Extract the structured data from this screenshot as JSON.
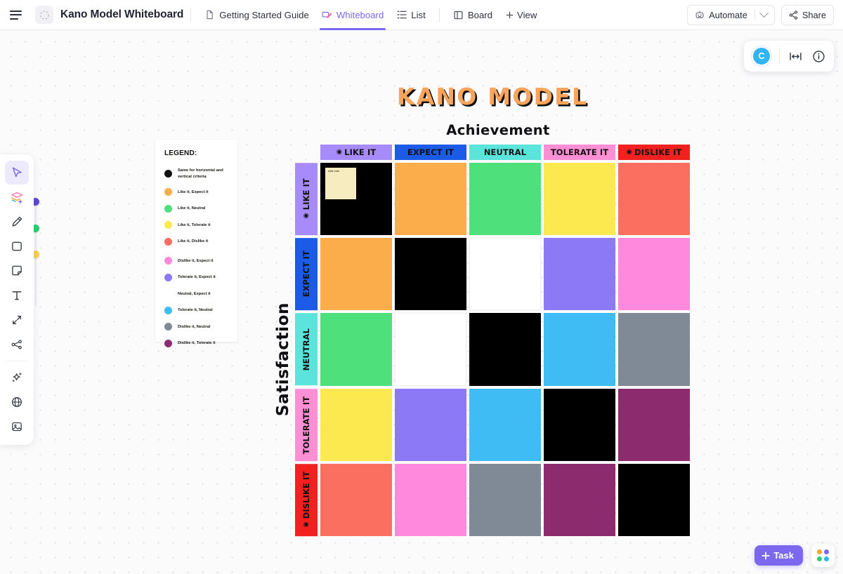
{
  "topbar": {
    "menu_icon": "hamburger-icon",
    "doc_icon": "document-spinner-icon",
    "title": "Kano Model Whiteboard",
    "tabs": [
      {
        "label": "Getting Started Guide",
        "icon": "doc-icon",
        "active": false
      },
      {
        "label": "Whiteboard",
        "icon": "whiteboard-icon",
        "active": true
      },
      {
        "label": "List",
        "icon": "list-icon",
        "active": false
      },
      {
        "label": "Board",
        "icon": "board-icon",
        "active": false
      }
    ],
    "add_view_label": "View",
    "automate_label": "Automate",
    "share_label": "Share"
  },
  "avatar_bar": {
    "avatar_initial": "C",
    "fit_icon": "fit-to-width-icon",
    "info_icon": "info-icon"
  },
  "toolbar": {
    "tools": [
      {
        "name": "select-tool",
        "icon": "cursor-icon",
        "selected": true
      },
      {
        "name": "shapes-tool",
        "icon": "layers-plus-icon",
        "selected": false
      },
      {
        "name": "pen-tool",
        "icon": "pen-icon",
        "selected": false
      },
      {
        "name": "rectangle-tool",
        "icon": "rectangle-icon",
        "selected": false
      },
      {
        "name": "sticky-note-tool",
        "icon": "sticky-note-icon",
        "selected": false
      },
      {
        "name": "text-tool",
        "icon": "text-icon",
        "selected": false
      },
      {
        "name": "connector-tool",
        "icon": "arrow-connector-icon",
        "selected": false
      },
      {
        "name": "flowchart-tool",
        "icon": "flowchart-icon",
        "selected": false
      },
      {
        "name": "ai-tool",
        "icon": "magic-wand-icon",
        "selected": false
      },
      {
        "name": "embed-tool",
        "icon": "globe-icon",
        "selected": false
      },
      {
        "name": "image-tool",
        "icon": "image-icon",
        "selected": false
      }
    ],
    "color_dots": [
      "#5b4ad9",
      "#2fcc71",
      "#f7d154"
    ]
  },
  "footer": {
    "task_label": "Task",
    "apps_icon": "apps-grid-icon",
    "apps_colors": [
      "#f5a623",
      "#7b68ee",
      "#2fcc71",
      "#31b5f2"
    ]
  },
  "legend": {
    "title": "LEGEND:",
    "items": [
      {
        "color": "#101010",
        "label": "Same for horizontal and vertical criteria"
      },
      {
        "color": "#FBAD4B",
        "label": "Like it, Expect it"
      },
      {
        "color": "#4EE07B",
        "label": "Like it, Neutral"
      },
      {
        "color": "#FCE94F",
        "label": "Like it, Tolerate it"
      },
      {
        "color": "#FB6F61",
        "label": "Like it, Dislike it"
      },
      {
        "color": "#FF89DD",
        "label": "Dislike it, Expect it"
      },
      {
        "color": "#8C79F5",
        "label": "Tolerate it, Expect it"
      },
      {
        "color": "#FFFFFF",
        "label": "Neutral, Expect it"
      },
      {
        "color": "#3FBCF4",
        "label": "Tolerate it, Neutral"
      },
      {
        "color": "#808A96",
        "label": "Dislike it, Neutral"
      },
      {
        "color": "#8C2B6E",
        "label": "Dislike it, Tolerate it"
      }
    ]
  },
  "board": {
    "title": "KANO MODEL",
    "title_color": "#FBA45C",
    "x_axis_label": "Achievement",
    "y_axis_label": "Satisfaction",
    "columns": [
      {
        "label": "LIKE IT",
        "bg": "#A78BFA",
        "icon": "smiley-icon"
      },
      {
        "label": "EXPECT IT",
        "bg": "#1B5BE8",
        "icon": ""
      },
      {
        "label": "NEUTRAL",
        "bg": "#5BE4DC",
        "icon": ""
      },
      {
        "label": "TOLERATE IT",
        "bg": "#FF8FD4",
        "icon": ""
      },
      {
        "label": "DISLIKE IT",
        "bg": "#F32020",
        "icon": "frowny-icon"
      }
    ],
    "rows": [
      {
        "label": "LIKE IT",
        "bg": "#A78BFA",
        "icon": "smiley-icon"
      },
      {
        "label": "EXPECT IT",
        "bg": "#1B5BE8",
        "icon": ""
      },
      {
        "label": "NEUTRAL",
        "bg": "#5BE4DC",
        "icon": ""
      },
      {
        "label": "TOLERATE IT",
        "bg": "#FF8FD4",
        "icon": ""
      },
      {
        "label": "DISLIKE IT",
        "bg": "#F32020",
        "icon": "frowny-icon"
      }
    ],
    "matrix": [
      [
        "#000000",
        "#FBAD4B",
        "#4EE07B",
        "#FCE94F",
        "#FB6F61"
      ],
      [
        "#FBAD4B",
        "#000000",
        "#FFFFFF",
        "#8C79F5",
        "#FF89DD"
      ],
      [
        "#4EE07B",
        "#FFFFFF",
        "#000000",
        "#3FBCF4",
        "#808A96"
      ],
      [
        "#FCE94F",
        "#8C79F5",
        "#3FBCF4",
        "#000000",
        "#8C2B6E"
      ],
      [
        "#FB6F61",
        "#FF89DD",
        "#808A96",
        "#8C2B6E",
        "#000000"
      ]
    ],
    "sticky_note": {
      "row": 0,
      "col": 0,
      "bg": "#F7ECC0",
      "text": "Add note"
    }
  }
}
